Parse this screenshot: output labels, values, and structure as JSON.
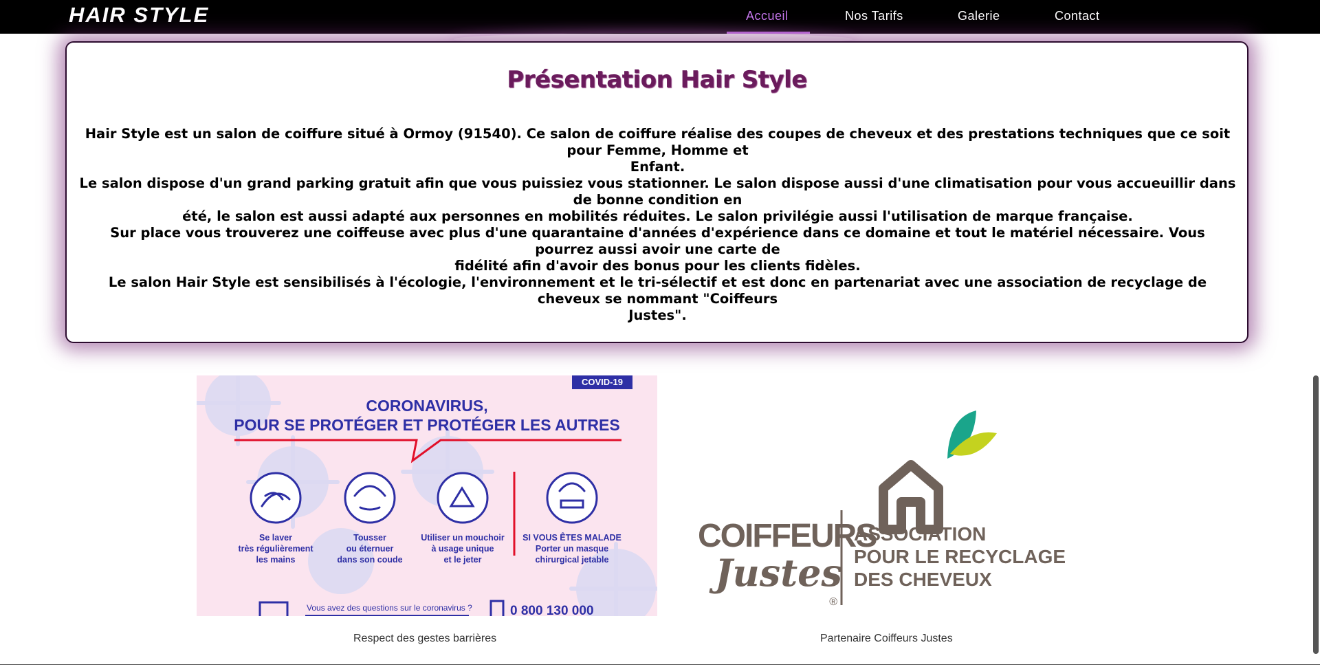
{
  "nav": {
    "brand": "HAIR STYLE",
    "items": [
      {
        "label": "Accueil",
        "active": true
      },
      {
        "label": "Nos Tarifs",
        "active": false
      },
      {
        "label": "Galerie",
        "active": false
      },
      {
        "label": "Contact",
        "active": false
      }
    ],
    "active_color": "#c879f0"
  },
  "presentation": {
    "title": "Présentation Hair Style",
    "paragraphs": [
      [
        "Hair Style est un salon de coiffure situé à Ormoy (91540). Ce salon de coiffure réalise des coupes de cheveux et des prestations techniques que ce soit pour Femme, Homme et",
        "Enfant."
      ],
      [
        "Le salon dispose d'un grand parking gratuit afin que vous puissiez vous stationner. Le salon dispose aussi d'une climatisation pour vous accueuillir dans de bonne condition en",
        "été, le salon est aussi adapté aux personnes en mobilités réduites. Le salon privilégie aussi l'utilisation de marque française."
      ],
      [
        "Sur place vous trouverez une coiffeuse avec plus d'une quarantaine d'années d'expérience dans ce domaine et tout le matériel nécessaire. Vous pourrez aussi avoir une carte de",
        "fidélité afin d'avoir des bonus pour les clients fidèles."
      ],
      [
        "Le salon Hair Style est sensibilisés à l'écologie, l'environnement et le tri-sélectif et est donc en partenariat avec une association de recyclage de cheveux se nommant \"Coiffeurs",
        "Justes\"."
      ]
    ]
  },
  "covid_poster": {
    "tag": "COVID-19",
    "title_line1": "CORONAVIRUS,",
    "title_line2": "POUR SE PROTÉGER ET PROTÉGER LES AUTRES",
    "gestures": [
      [
        "Se laver",
        "très régulièrement",
        "les mains"
      ],
      [
        "Tousser",
        "ou éternuer",
        "dans son coude"
      ],
      [
        "Utiliser un mouchoir",
        "à usage unique",
        "et le jeter"
      ],
      [
        "SI VOUS ÊTES MALADE",
        "Porter un masque",
        "chirurgical jetable"
      ]
    ],
    "question": "Vous avez des questions sur le coronavirus ?",
    "phone": "0 800 130 000"
  },
  "coiffeurs_justes": {
    "word1": "COIFFEURS",
    "word2": "Justes",
    "registered": "®",
    "assoc_line1": "ASSOCIATION",
    "assoc_line2": "POUR LE RECYCLAGE",
    "assoc_line3": "DES CHEVEUX"
  },
  "captions": {
    "covid": "Respect des gestes barrières",
    "partner": "Partenaire Coiffeurs Justes"
  }
}
